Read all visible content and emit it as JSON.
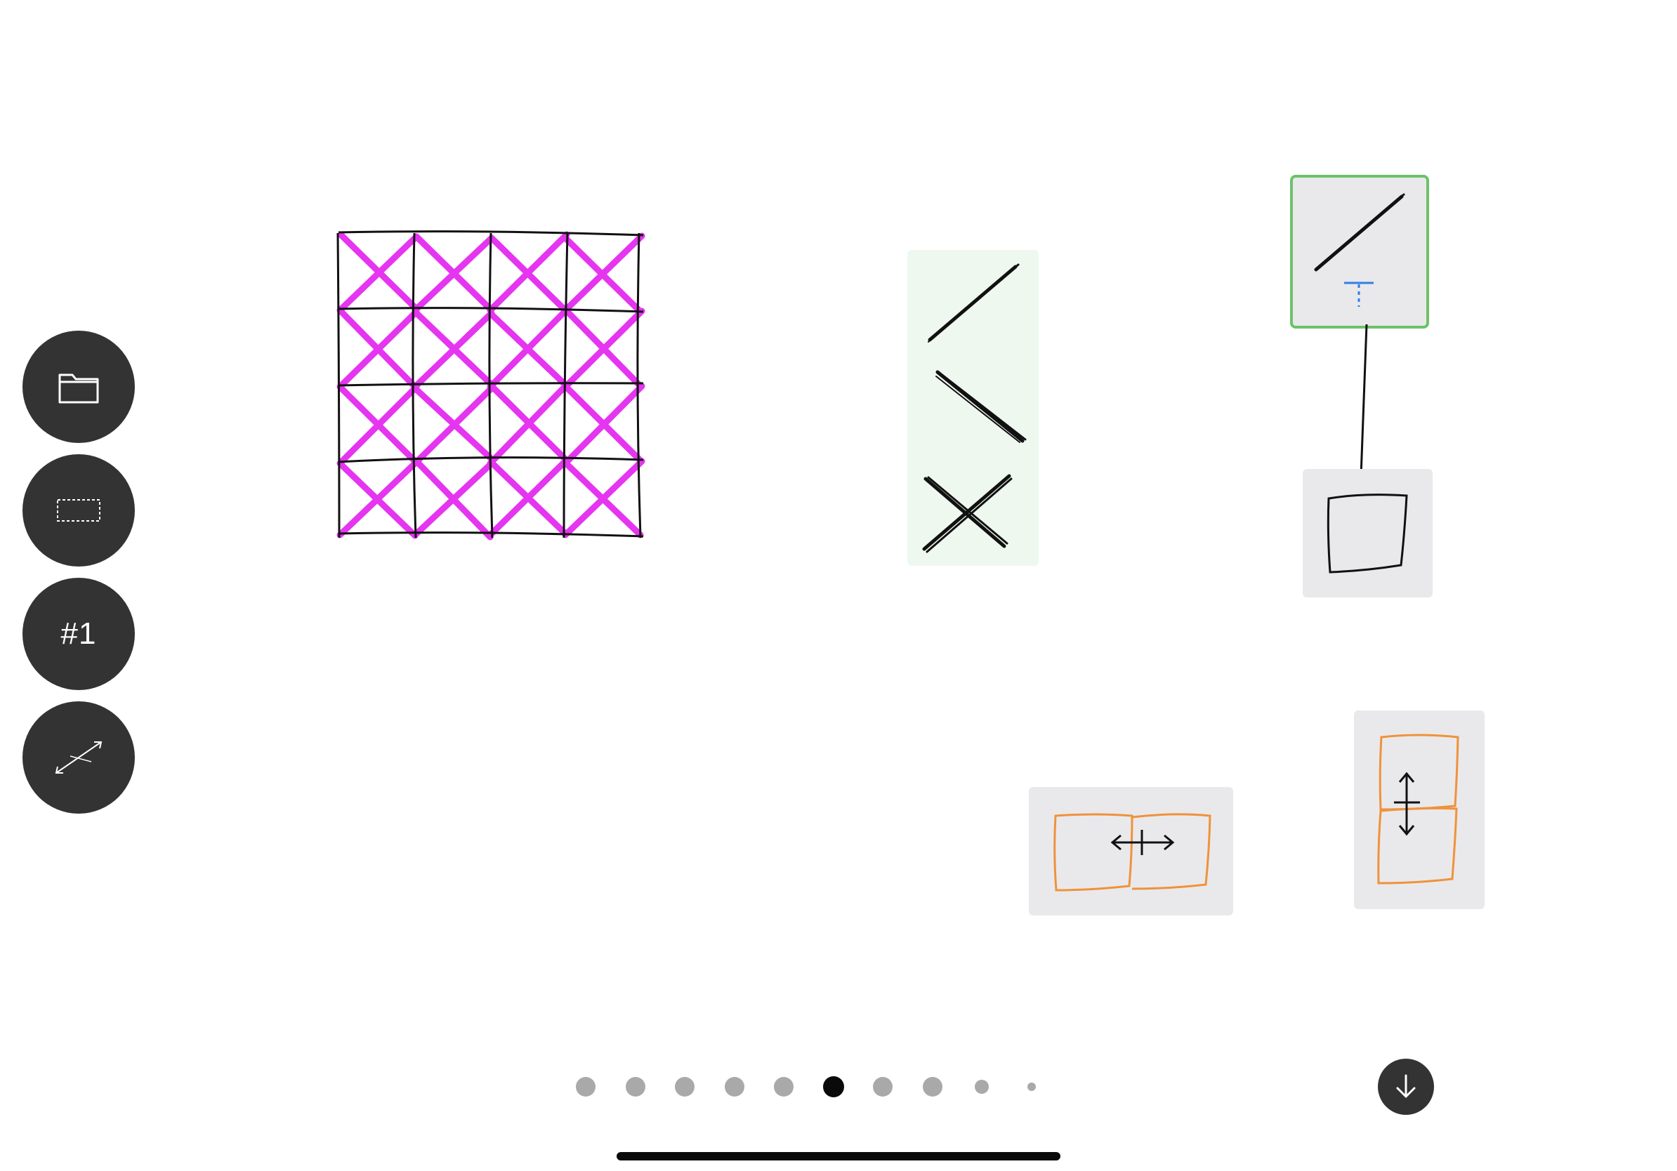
{
  "toolbar": {
    "buttons": [
      {
        "name": "folder",
        "icon": "folder-icon"
      },
      {
        "name": "select",
        "icon": "dashed-rectangle-icon"
      },
      {
        "name": "page",
        "label": "#1"
      },
      {
        "name": "scale",
        "icon": "diagonal-resize-icon"
      }
    ]
  },
  "colors": {
    "fab_background": "#333333",
    "grid_cross": "#e535f0",
    "stroke": "#111111",
    "palette_background": "#eef8ef",
    "card_background": "#e9e9eb",
    "selected_border": "#6cc26a",
    "text_cursor": "#2f7fe6",
    "split_box": "#f0923a"
  },
  "pager": {
    "page_count": 10,
    "active_index": 5
  },
  "actions": {
    "scroll_down_icon": "arrow-down-icon"
  }
}
